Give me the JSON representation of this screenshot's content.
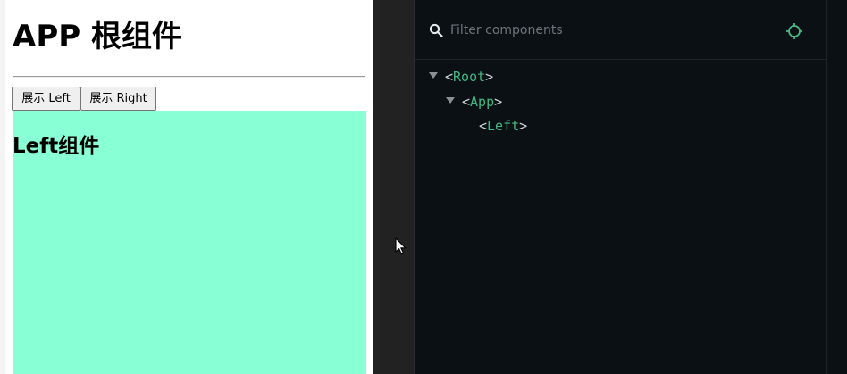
{
  "app": {
    "title": "APP 根组件",
    "buttons": {
      "show_left": "展示 Left",
      "show_right": "展示 Right"
    },
    "left_component": {
      "heading": "Left组件",
      "background": "#88ffd4"
    }
  },
  "devtools": {
    "filter": {
      "placeholder": "Filter components",
      "value": ""
    },
    "icons": {
      "search": "search-icon",
      "select_component": "target-icon"
    },
    "tree": [
      {
        "name": "Root",
        "open_bracket": "<",
        "close_bracket": ">"
      },
      {
        "name": "App",
        "open_bracket": "<",
        "close_bracket": ">"
      },
      {
        "name": "Left",
        "open_bracket": "<",
        "close_bracket": ">"
      }
    ],
    "colors": {
      "background": "#0b1014",
      "tag": "#42b883",
      "accent": "#42b883"
    }
  }
}
